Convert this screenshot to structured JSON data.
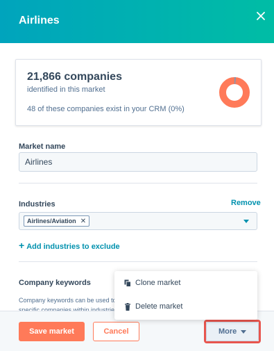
{
  "header": {
    "title": "Airlines"
  },
  "stats": {
    "count": "21,866 companies",
    "subtitle": "identified in this market",
    "crm_text": "48 of these companies exist in your CRM (0%)",
    "crm_fraction": 0.002,
    "colors": {
      "ring": "#ff7a59",
      "crm": "#7c98b6"
    }
  },
  "market_name": {
    "label": "Market name",
    "value": "Airlines"
  },
  "industries": {
    "label": "Industries",
    "remove_label": "Remove",
    "selected": [
      "Airlines/Aviation"
    ],
    "add_exclude_label": "Add industries to exclude"
  },
  "keywords": {
    "label": "Company keywords",
    "description_line1": "Company keywords can be used to",
    "description_line2": "specific companies within industries"
  },
  "menu": {
    "clone_label": "Clone market",
    "delete_label": "Delete market"
  },
  "footer": {
    "save_label": "Save market",
    "cancel_label": "Cancel",
    "more_label": "More"
  },
  "icons": {
    "close": "close-icon",
    "clone": "copy-icon",
    "delete": "trash-icon",
    "plus": "plus-icon",
    "caret": "caret-down-icon"
  },
  "colors": {
    "accent": "#ff7a59",
    "link": "#0091ae",
    "header_start": "#00a4bd",
    "header_end": "#00bda5"
  }
}
